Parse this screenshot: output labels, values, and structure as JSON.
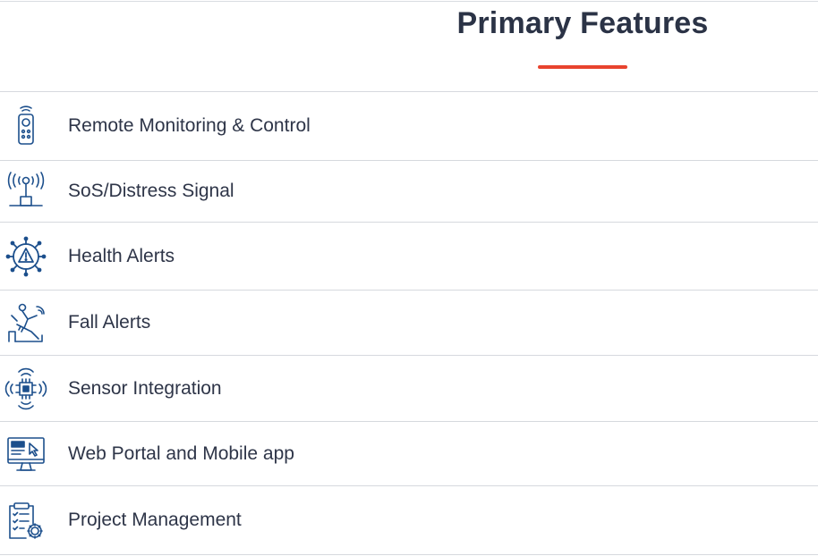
{
  "header": {
    "title": "Primary Features",
    "accent_color": "#e8432e"
  },
  "features": [
    {
      "label": "Remote Monitoring & Control",
      "icon": "remote-control-icon"
    },
    {
      "label": "SoS/Distress Signal",
      "icon": "antenna-signal-icon"
    },
    {
      "label": "Health Alerts",
      "icon": "virus-warning-icon"
    },
    {
      "label": "Fall Alerts",
      "icon": "falling-person-icon"
    },
    {
      "label": "Sensor Integration",
      "icon": "sensor-chip-icon"
    },
    {
      "label": "Web Portal and Mobile app",
      "icon": "monitor-cursor-icon"
    },
    {
      "label": "Project Management",
      "icon": "clipboard-gear-icon"
    }
  ],
  "colors": {
    "icon": "#1c4f8c",
    "text": "#2e3548",
    "divider": "#d6d9de"
  }
}
